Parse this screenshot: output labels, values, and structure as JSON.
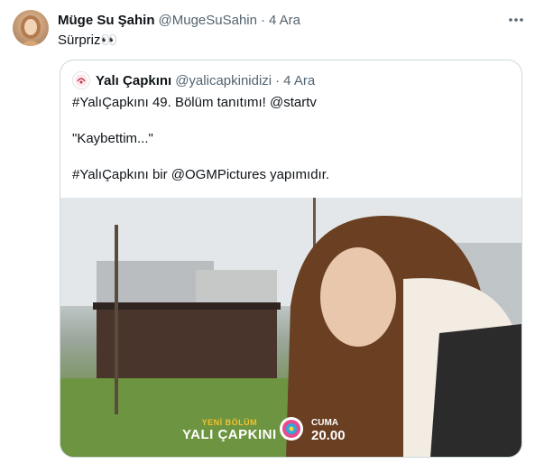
{
  "tweet": {
    "author_name": "Müge Su Şahin",
    "author_handle": "@MugeSuSahin",
    "separator": "·",
    "time": "4 Ara",
    "text": "Sürpriz👀",
    "more_icon": "more-horizontal-icon"
  },
  "quote": {
    "author_name": "Yalı Çapkını",
    "author_handle": "@yalicapkinidizi",
    "separator": "·",
    "time": "4 Ara",
    "line1": "#YalıÇapkını 49. Bölüm tanıtımı! @startv",
    "line2": "\"Kaybettim...\"",
    "line3": "#YalıÇapkını bir @OGMPictures yapımıdır.",
    "media": {
      "badge_sub": "YENİ BÖLÜM",
      "badge_main": "YALI ÇAPKINI",
      "day": "CUMA",
      "hour": "20.00",
      "network_logo": "star-tv-logo"
    }
  }
}
